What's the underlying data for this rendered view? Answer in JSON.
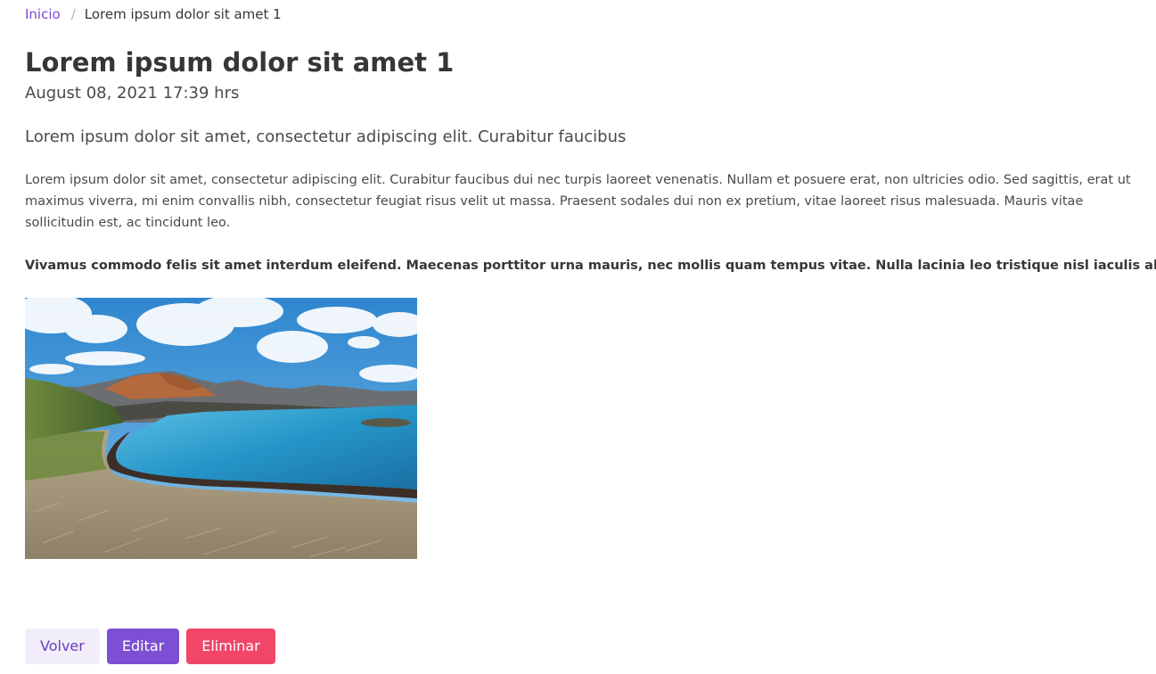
{
  "breadcrumb": {
    "home": "Inicio",
    "separator": "/",
    "current": "Lorem ipsum dolor sit amet 1"
  },
  "post": {
    "title": "Lorem ipsum dolor sit amet 1",
    "date": "August 08, 2021 17:39 hrs",
    "subtitle": "Lorem ipsum dolor sit amet, consectetur adipiscing elit. Curabitur faucibus",
    "body": "Lorem ipsum dolor sit amet, consectetur adipiscing elit. Curabitur faucibus dui nec turpis laoreet venenatis. Nullam et posuere erat, non ultricies odio. Sed sagittis, erat ut maximus viverra, mi enim convallis nibh, consectetur feugiat risus velit ut massa. Praesent sodales dui non ex pretium, vitae laoreet risus malesuada. Mauris vitae sollicitudin est, ac tincidunt leo.",
    "bold_text": "Vivamus commodo felis sit amet interdum eleifend. Maecenas porttitor urna mauris, nec mollis quam tempus vitae. Nulla lacinia leo tristique nisl iaculis aliquet."
  },
  "actions": {
    "back": "Volver",
    "edit": "Editar",
    "delete": "Eliminar"
  },
  "colors": {
    "link": "#7f4ad1",
    "primary": "#7c4fd4",
    "light": "#f1edfb",
    "danger": "#f14668"
  }
}
